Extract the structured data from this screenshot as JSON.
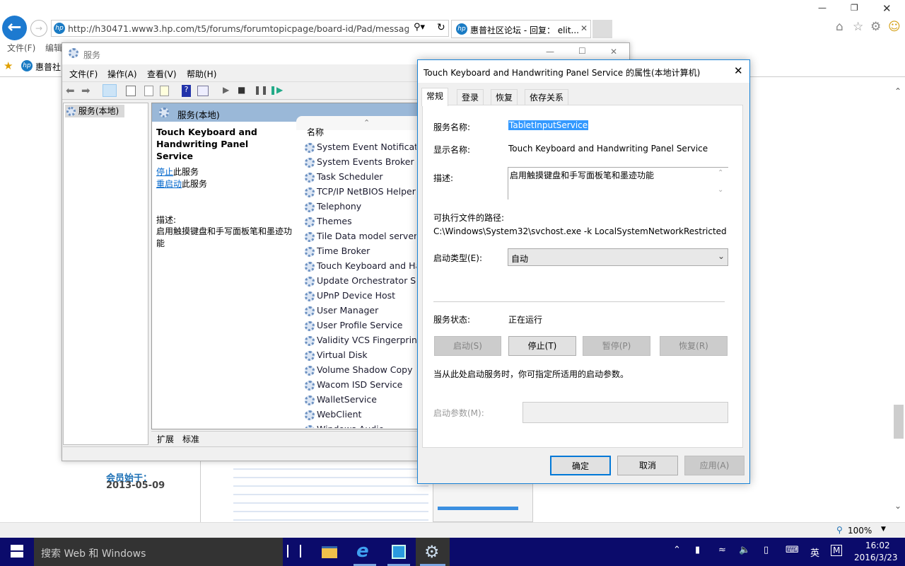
{
  "browser": {
    "url": "http://h30471.www3.hp.com/t5/forums/forumtopicpage/board-id/Pad/message-id/",
    "tab_label": "惠普社区论坛 - 回复： elit...",
    "menu": [
      "文件(F)",
      "编辑"
    ],
    "favorite": "惠普社",
    "zoom": "100%",
    "page": {
      "member_since_label": "会员始于：",
      "member_since_date": "2013-05-09"
    }
  },
  "services_window": {
    "title": "服务",
    "menu": [
      "文件(F)",
      "操作(A)",
      "查看(V)",
      "帮助(H)"
    ],
    "tree_item": "服务(本地)",
    "header": "服务(本地)",
    "detail": {
      "service_name": "Touch Keyboard and Handwriting Panel Service",
      "stop_link": "停止",
      "stop_suffix": "此服务",
      "restart_link": "重启动",
      "restart_suffix": "此服务",
      "desc_label": "描述:",
      "desc": "启用触摸键盘和手写面板笔和墨迹功能"
    },
    "column_name": "名称",
    "services": [
      "System Event Notificatio",
      "System Events Broker",
      "Task Scheduler",
      "TCP/IP NetBIOS Helper",
      "Telephony",
      "Themes",
      "Tile Data model server",
      "Time Broker",
      "Touch Keyboard and Ha",
      "Update Orchestrator Se",
      "UPnP Device Host",
      "User Manager",
      "User Profile Service",
      "Validity VCS Fingerprint",
      "Virtual Disk",
      "Volume Shadow Copy",
      "Wacom ISD Service",
      "WalletService",
      "WebClient",
      "Windows Audio"
    ],
    "bottom_tabs": [
      "扩展",
      "标准"
    ]
  },
  "dialog": {
    "title": "Touch Keyboard and Handwriting Panel Service 的属性(本地计算机)",
    "tabs": [
      "常规",
      "登录",
      "恢复",
      "依存关系"
    ],
    "service_name_label": "服务名称:",
    "service_name": "TabletInputService",
    "display_name_label": "显示名称:",
    "display_name": "Touch Keyboard and Handwriting Panel Service",
    "desc_label": "描述:",
    "desc": "启用触摸键盘和手写面板笔和墨迹功能",
    "path_label": "可执行文件的路径:",
    "path": "C:\\Windows\\System32\\svchost.exe -k LocalSystemNetworkRestricted",
    "startup_type_label": "启动类型(E):",
    "startup_type": "自动",
    "status_label": "服务状态:",
    "status": "正在运行",
    "buttons": {
      "start": "启动(S)",
      "stop": "停止(T)",
      "pause": "暂停(P)",
      "resume": "恢复(R)"
    },
    "hint": "当从此处启动服务时，你可指定所适用的启动参数。",
    "params_label": "启动参数(M):",
    "params_value": "",
    "ok": "确定",
    "cancel": "取消",
    "apply": "应用(A)"
  },
  "taskbar": {
    "search": "搜索 Web 和 Windows",
    "ime": "英",
    "time": "16:02",
    "date": "2016/3/23",
    "color": "#0b0b6b"
  }
}
